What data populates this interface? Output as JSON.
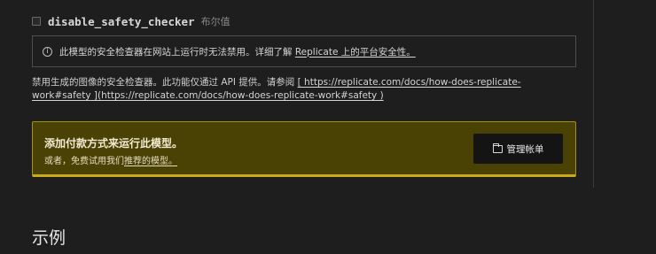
{
  "field": {
    "name": "disable_safety_checker",
    "type": "布尔值"
  },
  "info_box": {
    "text_before": "此模型的安全检查器在网站上运行时无法禁用。详细了解 ",
    "link_text": "Replicate 上的平台安全性。"
  },
  "description": {
    "text": "禁用生成的图像的安全检查器。此功能仅通过 API 提供。请参阅 ",
    "link_text": "[ https://replicate.com/docs/how-does-replicate-work#safety ](https://replicate.com/docs/how-does-replicate-work#safety )"
  },
  "notice": {
    "title": "添加付款方式来运行此模型。",
    "sub_text": "或者，免费试用我们",
    "sub_link": "推荐的模型。",
    "button_label": "管理帐单"
  },
  "section": {
    "title": "示例"
  }
}
